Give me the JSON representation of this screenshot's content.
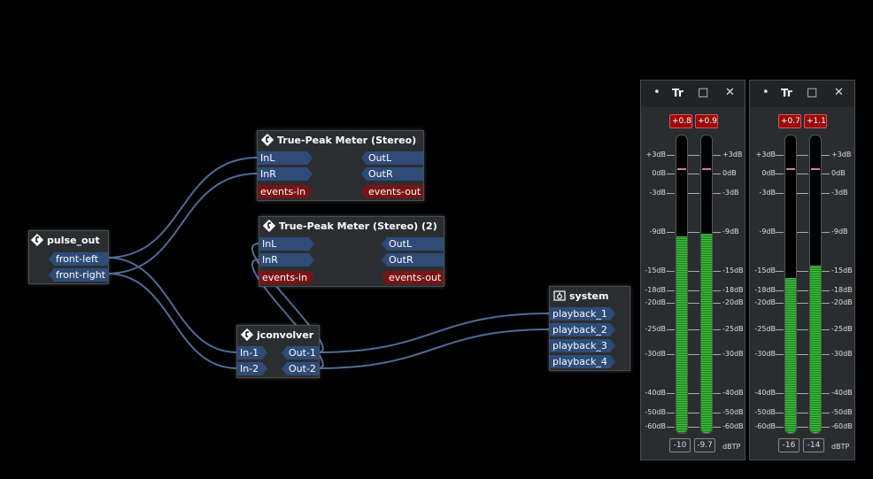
{
  "nodes": {
    "pulse_out": {
      "title": "pulse_out",
      "ports": [
        "front-left",
        "front-right"
      ]
    },
    "tpm1": {
      "title": "True-Peak Meter (Stereo)",
      "inputs": [
        "InL",
        "InR",
        "events-in"
      ],
      "outputs": [
        "OutL",
        "OutR",
        "events-out"
      ]
    },
    "tpm2": {
      "title": "True-Peak Meter (Stereo) (2)",
      "inputs": [
        "InL",
        "InR",
        "events-in"
      ],
      "outputs": [
        "OutL",
        "OutR",
        "events-out"
      ]
    },
    "jconvolver": {
      "title": "jconvolver",
      "inputs": [
        "In-1",
        "In-2"
      ],
      "outputs": [
        "Out-1",
        "Out-2"
      ]
    },
    "system": {
      "title": "system",
      "ports": [
        "playback_1",
        "playback_2",
        "playback_3",
        "playback_4"
      ]
    }
  },
  "meters": [
    {
      "title": "Tr",
      "peaks": [
        "+0.8",
        "+0.9"
      ],
      "levels_db": [
        -9.5,
        -9.2
      ],
      "readouts": [
        "-10",
        "-9.7"
      ],
      "unit": "dBTP"
    },
    {
      "title": "Tr",
      "peaks": [
        "+0.7",
        "+1.1"
      ],
      "levels_db": [
        -16,
        -14
      ],
      "readouts": [
        "-16",
        "-14"
      ],
      "unit": "dBTP"
    }
  ],
  "scale_labels": [
    "+3dB",
    "0dB",
    "-3dB",
    "-9dB",
    "-15dB",
    "-18dB",
    "-20dB",
    "-25dB",
    "-30dB",
    "-40dB",
    "-50dB",
    "-60dB"
  ],
  "buttons": {
    "dot": "•",
    "restore": "□",
    "close": "✕"
  },
  "colors": {
    "port_audio": "#2f4c78",
    "port_event": "#7a1414",
    "wire": "#4f6b96",
    "meter_green": "#3cc83c"
  }
}
